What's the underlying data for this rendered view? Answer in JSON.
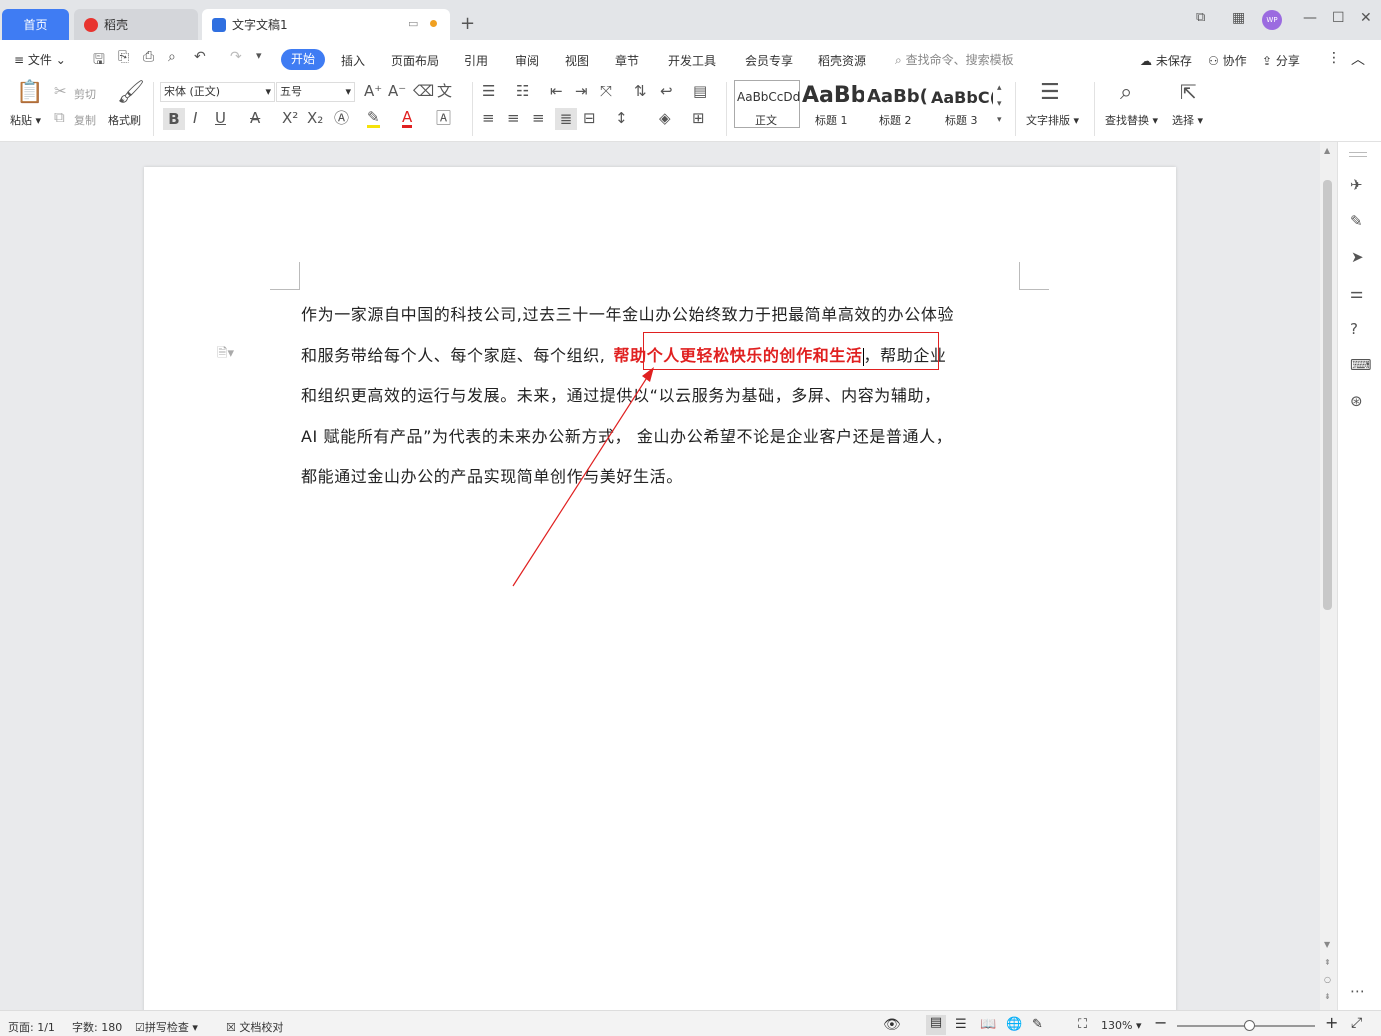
{
  "tabs": {
    "home": "首页",
    "daoke": "稻壳",
    "doc": "文字文稿1"
  },
  "window": {
    "avatar": "WP"
  },
  "menu": {
    "file": "文件",
    "items": [
      "开始",
      "插入",
      "页面布局",
      "引用",
      "审阅",
      "视图",
      "章节",
      "开发工具",
      "会员专享",
      "稻壳资源"
    ],
    "search_placeholder": "查找命令、搜索模板",
    "unsaved": "未保存",
    "collab": "协作",
    "share": "分享"
  },
  "ribbon": {
    "paste": "粘贴",
    "cut": "剪切",
    "copy": "复制",
    "format_painter": "格式刷",
    "font_name": "宋体 (正文)",
    "font_size": "五号",
    "styles": [
      {
        "preview": "AaBbCcDd",
        "label": "正文"
      },
      {
        "preview": "AaBb",
        "label": "标题 1"
      },
      {
        "preview": "AaBb(",
        "label": "标题 2"
      },
      {
        "preview": "AaBbC(",
        "label": "标题 3"
      }
    ],
    "text_layout": "文字排版",
    "find_replace": "查找替换",
    "select": "选择"
  },
  "document": {
    "lines": [
      "作为一家源自中国的科技公司,过去三十一年金山办公始终致力于把最简单高效的办公体验",
      "和服务带给每个人、每个家庭、每个组织,",
      "和组织更高效的运行与发展。未来，通过提供以“以云服务为基础，多屏、内容为辅助，",
      "AI  赋能所有产品”为代表的未来办公新方式，  金山办公希望不论是企业客户还是普通人，",
      "都能通过金山办公的产品实现简单创作与美好生活。"
    ],
    "highlight": "帮助个人更轻松快乐的创作和生活",
    "line2_tail": "，帮助企业",
    "accent": "#e02020"
  },
  "status": {
    "page": "页面: 1/1",
    "words": "字数: 180",
    "spell": "拼写检查",
    "proof": "文档校对",
    "zoom": "130%"
  }
}
